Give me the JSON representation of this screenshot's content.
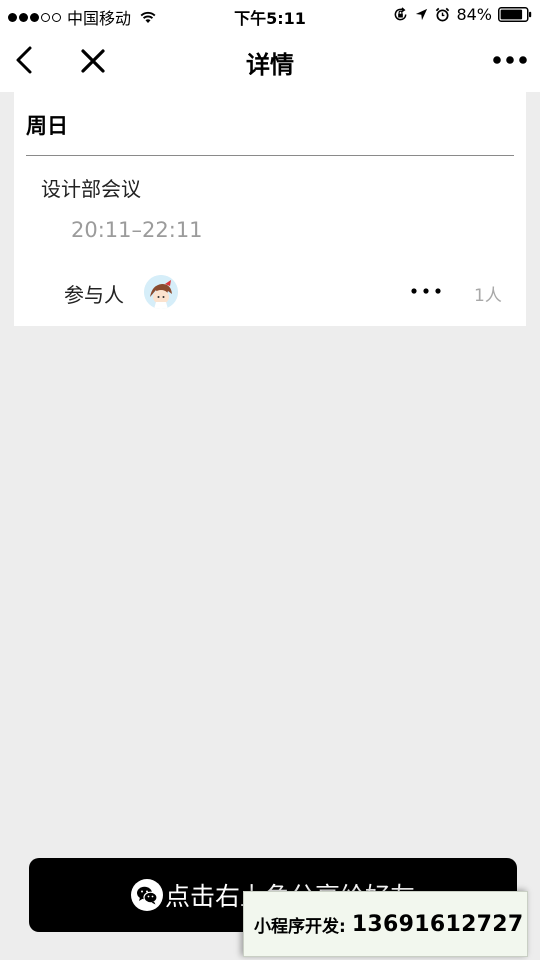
{
  "status_bar": {
    "carrier": "中国移动",
    "time": "下午5:11",
    "battery": "84%"
  },
  "nav": {
    "title": "详情"
  },
  "card": {
    "day": "周日",
    "event_title": "设计部会议",
    "event_time": "20:11–22:11",
    "participant_label": "参与人",
    "participant_count": "1人"
  },
  "share_button": {
    "label": "点击右上角分享给好友"
  },
  "promo": {
    "label": "小程序开发:",
    "phone": "13691612727"
  },
  "icons": {
    "status": [
      "signal-icon",
      "wifi-icon",
      "lock-rotation-icon",
      "location-arrow-icon",
      "alarm-icon",
      "battery-icon"
    ],
    "nav": [
      "back-chevron-icon",
      "close-icon",
      "more-icon"
    ],
    "card": [
      "avatar",
      "more-icon"
    ],
    "button": [
      "wechat-icon"
    ]
  },
  "colors": {
    "page_background": "#ededed",
    "card_background": "#ffffff",
    "button_background": "#000000",
    "secondary_text": "#9b9b9b"
  }
}
